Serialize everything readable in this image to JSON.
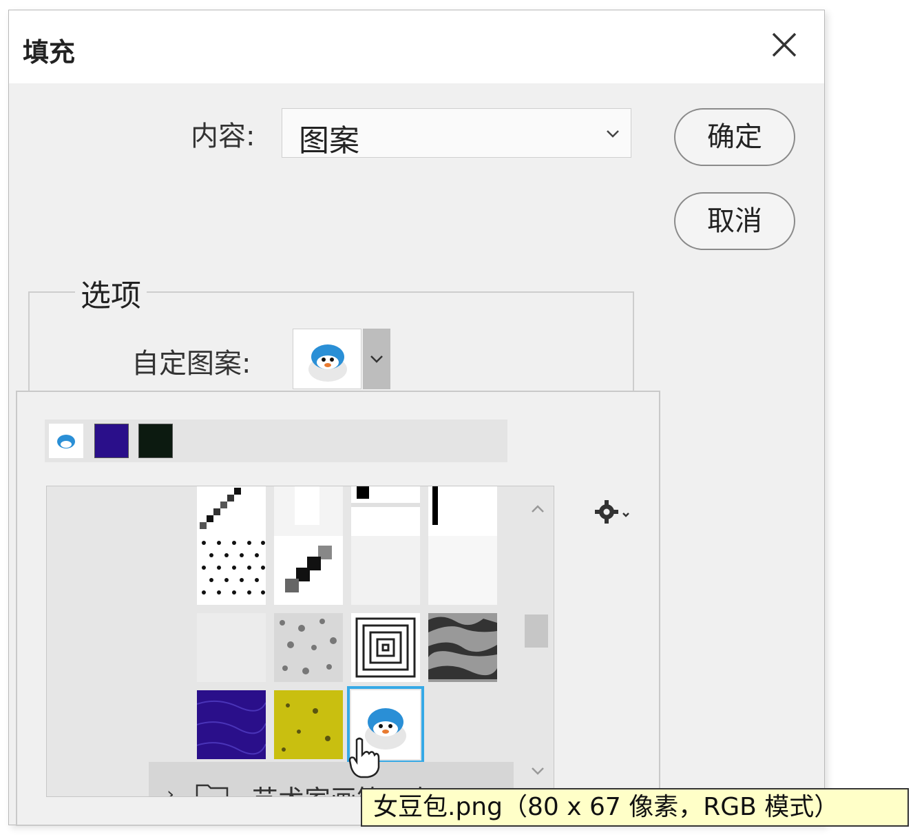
{
  "dialog": {
    "title": "填充",
    "content_label": "内容:",
    "content_value": "图案",
    "ok_label": "确定",
    "cancel_label": "取消"
  },
  "options": {
    "legend": "选项",
    "custom_pattern_label": "自定图案:"
  },
  "picker": {
    "folder_name": "艺术家画笔画布"
  },
  "tooltip": {
    "text": "女豆包.png（80 x 67 像素，RGB 模式）"
  },
  "icons": [
    "close-icon",
    "chevron-down-icon",
    "gear-icon",
    "chevron-up-icon",
    "folder-icon",
    "hand-cursor-icon"
  ],
  "colors": {
    "selection": "#36a9e6",
    "tooltip_bg": "#ffffc8",
    "purple_pattern": "#2a0f8a",
    "yellow_pattern": "#c9bf10"
  }
}
